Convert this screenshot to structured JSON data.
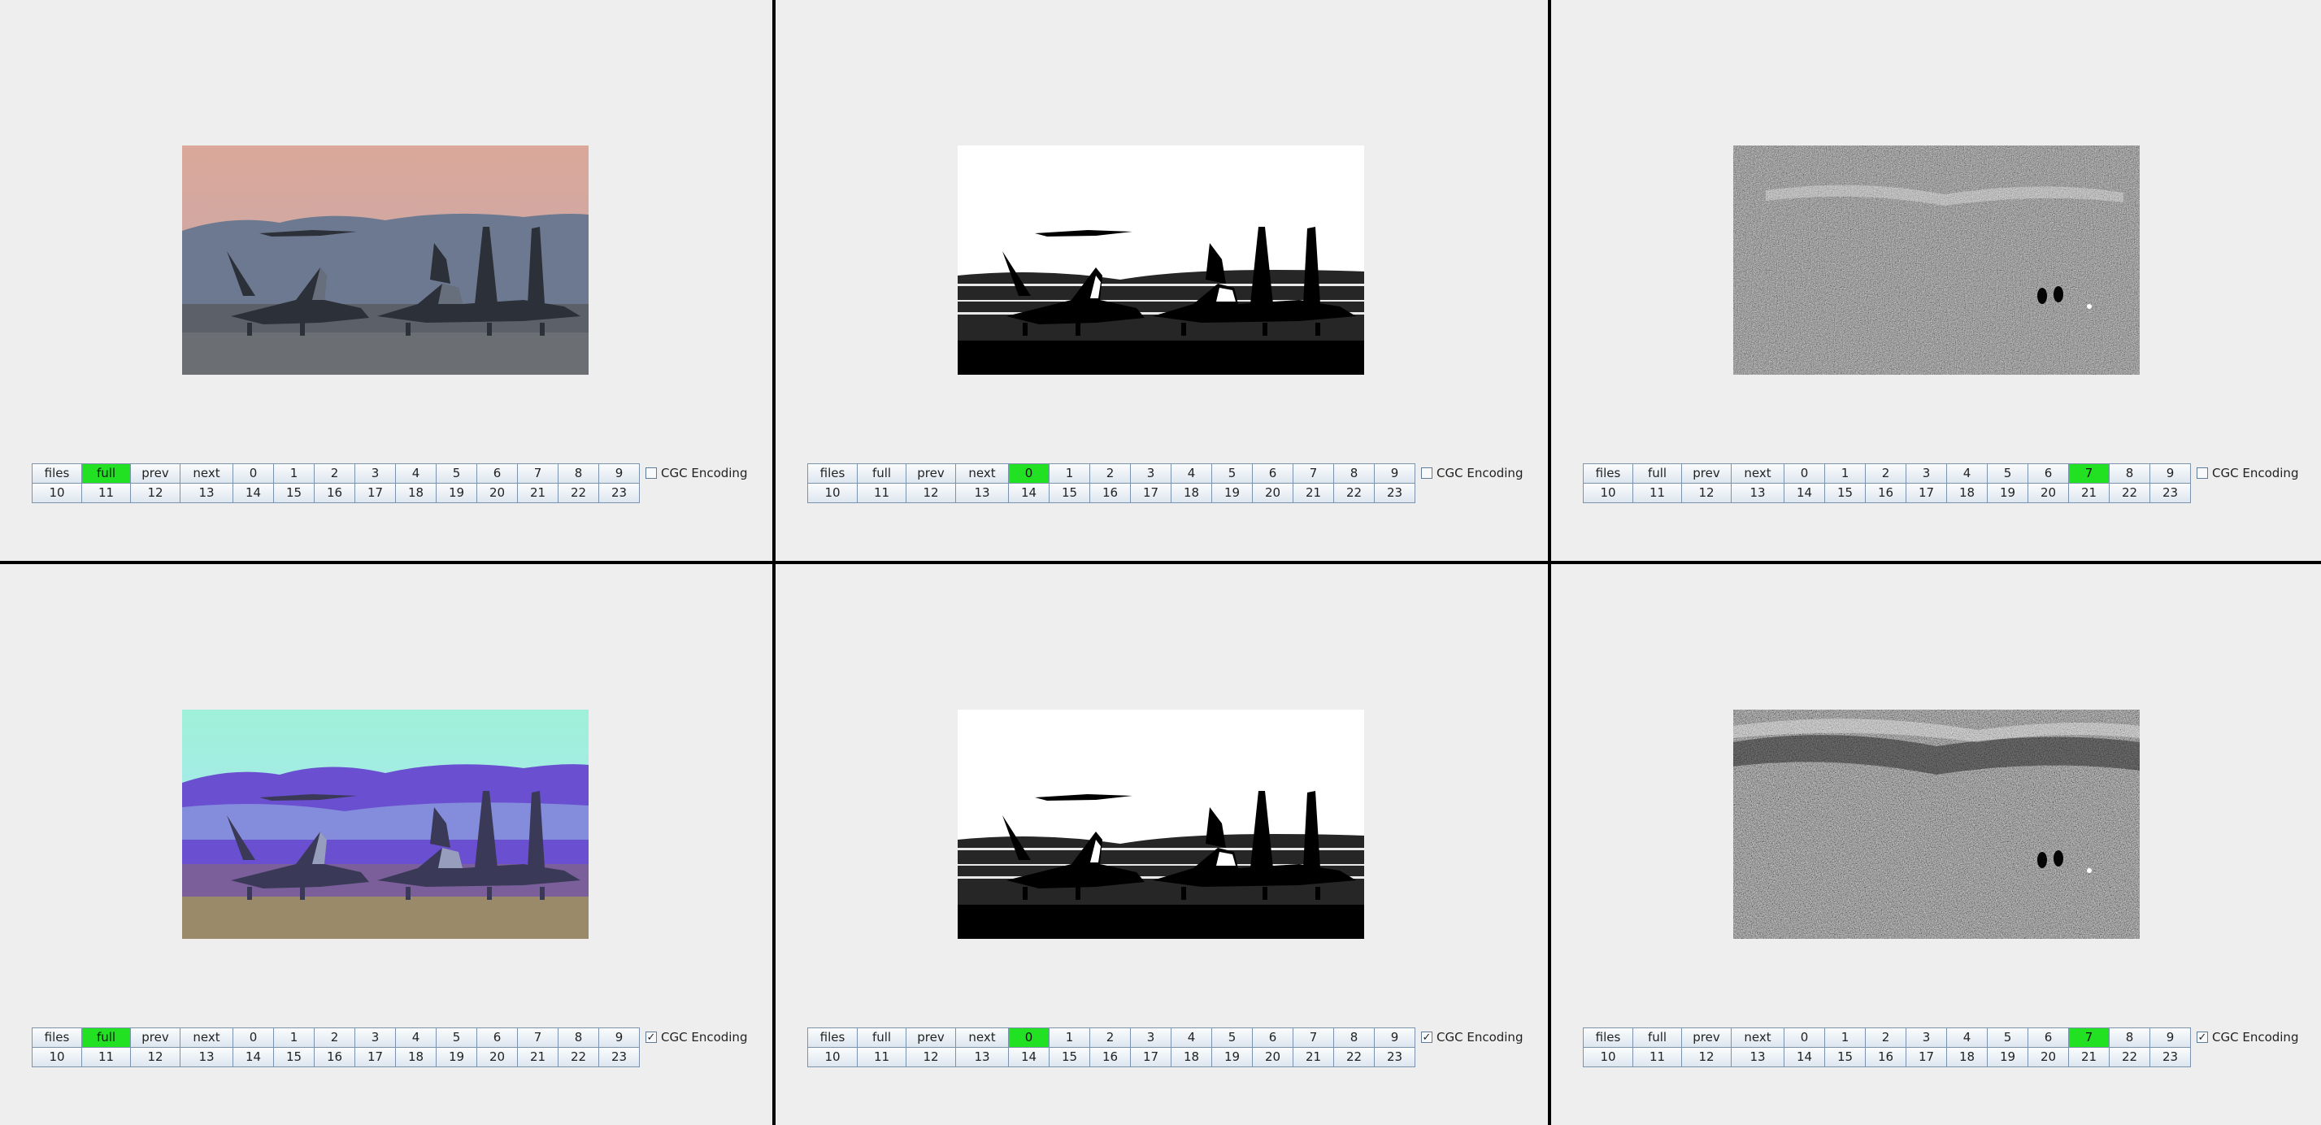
{
  "buttons_row1": [
    "files",
    "full",
    "prev",
    "next",
    "0",
    "1",
    "2",
    "3",
    "4",
    "5",
    "6",
    "7",
    "8",
    "9"
  ],
  "buttons_row2": [
    "10",
    "11",
    "12",
    "13",
    "14",
    "15",
    "16",
    "17",
    "18",
    "19",
    "20",
    "21",
    "22",
    "23"
  ],
  "checkbox_label": "CGC Encoding",
  "checkmark_glyph": "✓",
  "active_color": "#22e022",
  "panels": [
    {
      "id": "p1",
      "image": "color-photo",
      "active": "full",
      "cgc_checked": false
    },
    {
      "id": "p2",
      "image": "bitplane-0",
      "active": "0",
      "cgc_checked": false
    },
    {
      "id": "p3",
      "image": "bitplane-7",
      "active": "7",
      "cgc_checked": false
    },
    {
      "id": "p4",
      "image": "color-photo-cgc",
      "active": "full",
      "cgc_checked": true
    },
    {
      "id": "p5",
      "image": "bitplane-0-cgc",
      "active": "0",
      "cgc_checked": true
    },
    {
      "id": "p6",
      "image": "bitplane-7-cgc",
      "active": "7",
      "cgc_checked": true
    }
  ]
}
